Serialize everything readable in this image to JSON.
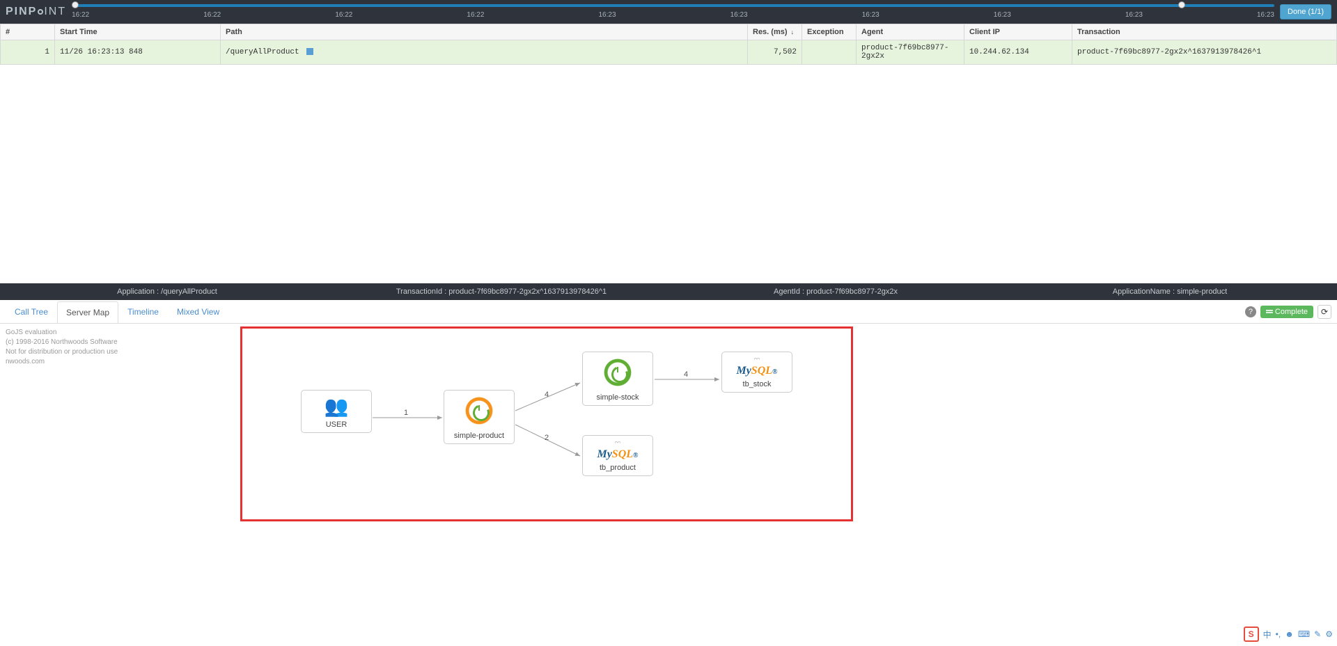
{
  "brand": {
    "pin": "PINP",
    "oint": "INT"
  },
  "timeline": {
    "ticks": [
      "16:22",
      "16:22",
      "16:22",
      "16:22",
      "16:23",
      "16:23",
      "16:23",
      "16:23",
      "16:23",
      "16:23"
    ],
    "done_label": "Done (1/1)"
  },
  "table": {
    "headers": {
      "idx": "#",
      "start": "Start Time",
      "path": "Path",
      "res": "Res. (ms)",
      "exc": "Exception",
      "agent": "Agent",
      "ip": "Client IP",
      "txn": "Transaction"
    },
    "row": {
      "idx": "1",
      "start": "11/26 16:23:13 848",
      "path": "/queryAllProduct",
      "res": "7,502",
      "exc": "",
      "agent": "product-7f69bc8977-2gx2x",
      "ip": "10.244.62.134",
      "txn": "product-7f69bc8977-2gx2x^1637913978426^1"
    }
  },
  "infobar": {
    "app": "Application : /queryAllProduct",
    "txn": "TransactionId : product-7f69bc8977-2gx2x^1637913978426^1",
    "agent": "AgentId : product-7f69bc8977-2gx2x",
    "appname": "ApplicationName : simple-product"
  },
  "tabs": {
    "calltree": "Call Tree",
    "servermap": "Server Map",
    "timeline": "Timeline",
    "mixed": "Mixed View",
    "complete": "Complete"
  },
  "watermark": {
    "l1": "GoJS evaluation",
    "l2": "(c) 1998-2016 Northwoods Software",
    "l3": "Not for distribution or production use",
    "l4": "nwoods.com"
  },
  "nodes": {
    "user": "USER",
    "simple_product": "simple-product",
    "simple_stock": "simple-stock",
    "tb_product": "tb_product",
    "tb_stock": "tb_stock"
  },
  "edges": {
    "e1": "1",
    "e2": "4",
    "e3": "2",
    "e4": "4"
  },
  "mysql": {
    "my": "My",
    "sql": "SQL"
  },
  "ime": {
    "s": "S",
    "zh": "中"
  }
}
